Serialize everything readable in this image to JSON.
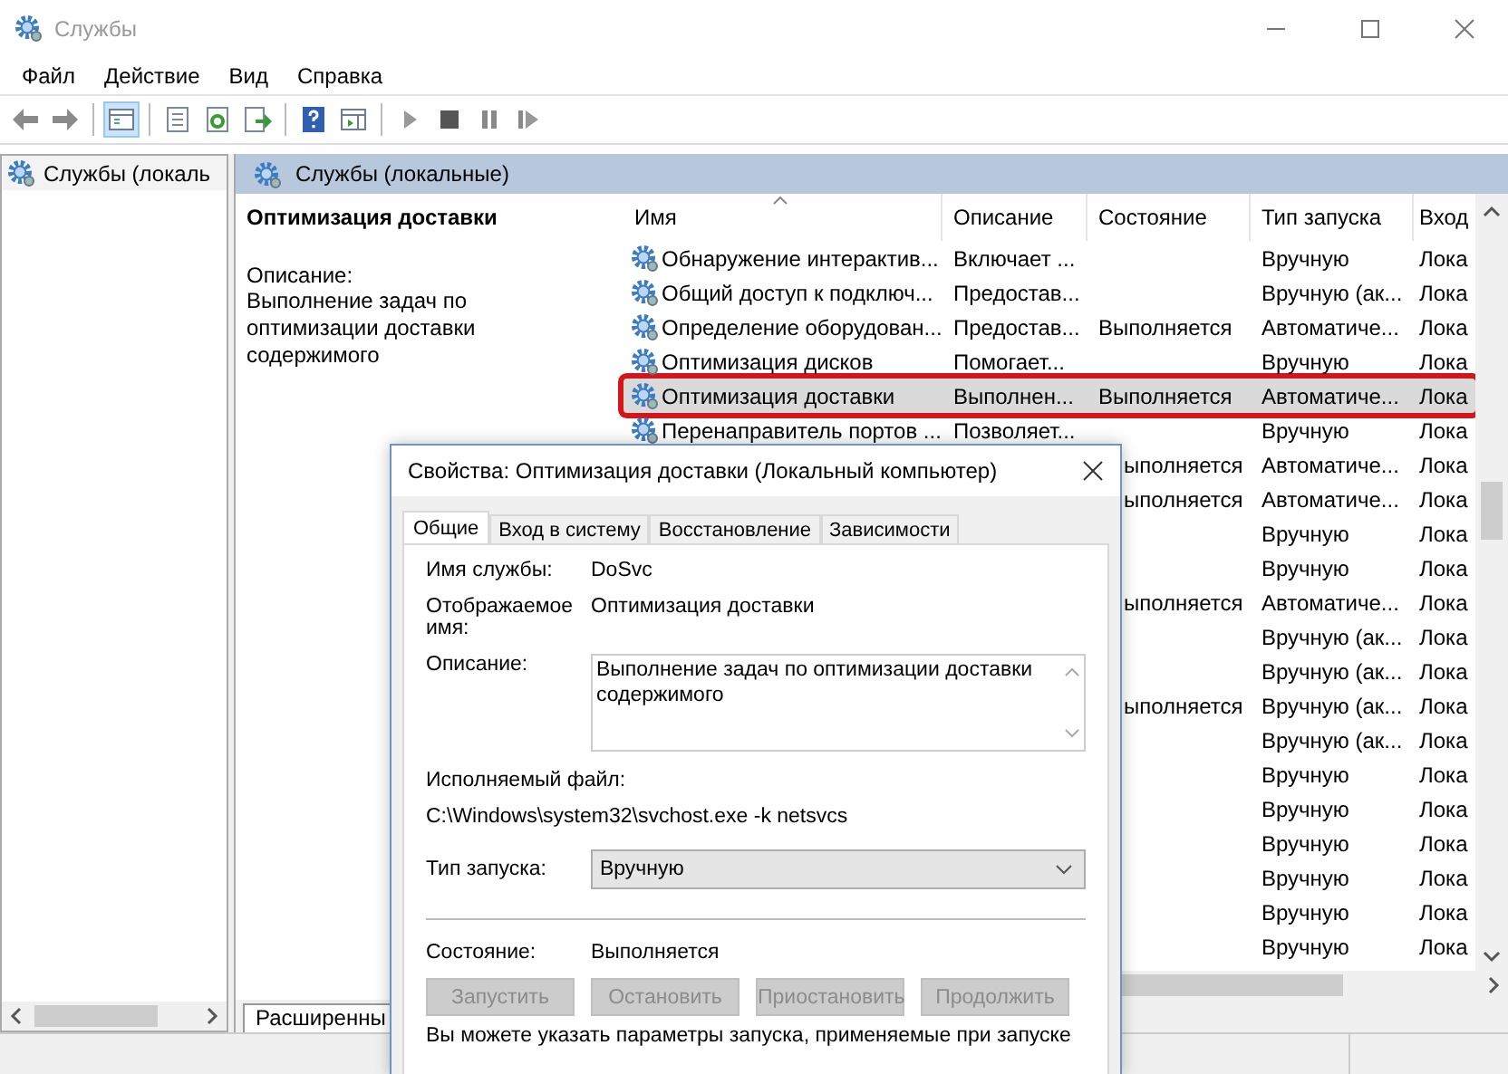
{
  "window": {
    "title": "Службы"
  },
  "menu": [
    "Файл",
    "Действие",
    "Вид",
    "Справка"
  ],
  "toolbar": [
    {
      "kind": "back",
      "pressed": false
    },
    {
      "kind": "forward",
      "pressed": false
    },
    {
      "kind": "separator"
    },
    {
      "kind": "console-tree",
      "pressed": true
    },
    {
      "kind": "separator"
    },
    {
      "kind": "properties",
      "pressed": false
    },
    {
      "kind": "refresh",
      "pressed": false
    },
    {
      "kind": "export",
      "pressed": false
    },
    {
      "kind": "separator"
    },
    {
      "kind": "help",
      "pressed": false
    },
    {
      "kind": "action-pane",
      "pressed": false
    },
    {
      "kind": "separator"
    },
    {
      "kind": "play",
      "pressed": false
    },
    {
      "kind": "stop",
      "pressed": false
    },
    {
      "kind": "pause",
      "pressed": false
    },
    {
      "kind": "resume",
      "pressed": false
    }
  ],
  "tree": {
    "items": [
      {
        "label": "Службы (локаль"
      }
    ]
  },
  "pane_header": "Службы (локальные)",
  "details": {
    "title": "Оптимизация доставки",
    "description_label": "Описание:",
    "description": "Выполнение задач по оптимизации доставки содержимого"
  },
  "table": {
    "columns": [
      "Имя",
      "Описание",
      "Состояние",
      "Тип запуска",
      "Вход"
    ],
    "rows": [
      {
        "name": "Обнаружение интерактив...",
        "description": "Включает ...",
        "startup": "Вручную",
        "logon": "Лока",
        "selected": false
      },
      {
        "name": "Общий доступ к подключ...",
        "description": "Предостав...",
        "startup": "Вручную (ак...",
        "logon": "Лока",
        "selected": false
      },
      {
        "name": "Определение оборудован...",
        "description": "Предостав...",
        "status": "Выполняется",
        "startup": "Автоматиче...",
        "logon": "Лока",
        "selected": false
      },
      {
        "name": "Оптимизация дисков",
        "description": "Помогает...",
        "startup": "Вручную",
        "logon": "Лока",
        "selected": false
      },
      {
        "name": "Оптимизация доставки",
        "description": "Выполнен...",
        "status": "Выполняется",
        "startup": "Автоматиче...",
        "logon": "Лока",
        "selected": true
      },
      {
        "name": "Перенаправитель портов ...",
        "description": "Позволяет...",
        "startup": "Вручную",
        "logon": "Лока",
        "selected": false
      },
      {
        "status": "ыполняется",
        "startup": "Автоматиче...",
        "logon": "Лока",
        "selected": false
      },
      {
        "status": "ыполняется",
        "startup": "Автоматиче...",
        "logon": "Лока",
        "selected": false
      },
      {
        "startup": "Вручную",
        "logon": "Лока",
        "selected": false
      },
      {
        "startup": "Вручную",
        "logon": "Лока",
        "selected": false
      },
      {
        "status": "ыполняется",
        "startup": "Автоматиче...",
        "logon": "Лока",
        "selected": false
      },
      {
        "startup": "Вручную (ак...",
        "logon": "Лока",
        "selected": false
      },
      {
        "startup": "Вручную (ак...",
        "logon": "Лока",
        "selected": false
      },
      {
        "status": "ыполняется",
        "startup": "Вручную (ак...",
        "logon": "Лока",
        "selected": false
      },
      {
        "startup": "Вручную (ак...",
        "logon": "Лока",
        "selected": false
      },
      {
        "startup": "Вручную",
        "logon": "Лока",
        "selected": false
      },
      {
        "startup": "Вручную",
        "logon": "Лока",
        "selected": false
      },
      {
        "startup": "Вручную",
        "logon": "Лока",
        "selected": false
      },
      {
        "startup": "Вручную",
        "logon": "Лока",
        "selected": false
      },
      {
        "startup": "Вручную",
        "logon": "Лока",
        "selected": false
      },
      {
        "startup": "Вручную",
        "logon": "Лока",
        "selected": false
      }
    ]
  },
  "view_tabs": [
    {
      "label": "Расширенны",
      "selected": true
    }
  ],
  "dialog": {
    "title": "Свойства: Оптимизация доставки (Локальный компьютер)",
    "tabs": [
      {
        "label": "Общие",
        "selected": true
      },
      {
        "label": "Вход в систему",
        "selected": false
      },
      {
        "label": "Восстановление",
        "selected": false
      },
      {
        "label": "Зависимости",
        "selected": false
      }
    ],
    "service_name_label": "Имя службы:",
    "service_name": "DoSvc",
    "display_name_label": "Отображаемое имя:",
    "display_name": "Оптимизация доставки",
    "description_label": "Описание:",
    "description": "Выполнение задач по оптимизации доставки содержимого",
    "executable_label": "Исполняемый файл:",
    "executable": "C:\\Windows\\system32\\svchost.exe -k netsvcs",
    "startup_label": "Тип запуска:",
    "startup": "Вручную",
    "status_label": "Состояние:",
    "status": "Выполняется",
    "buttons": [
      {
        "label": "Запустить",
        "disabled": true
      },
      {
        "label": "Остановить",
        "disabled": true
      },
      {
        "label": "Приостановить",
        "disabled": true
      },
      {
        "label": "Продолжить",
        "disabled": true
      }
    ],
    "note": "Вы можете указать параметры запуска, применяемые при запуске"
  }
}
